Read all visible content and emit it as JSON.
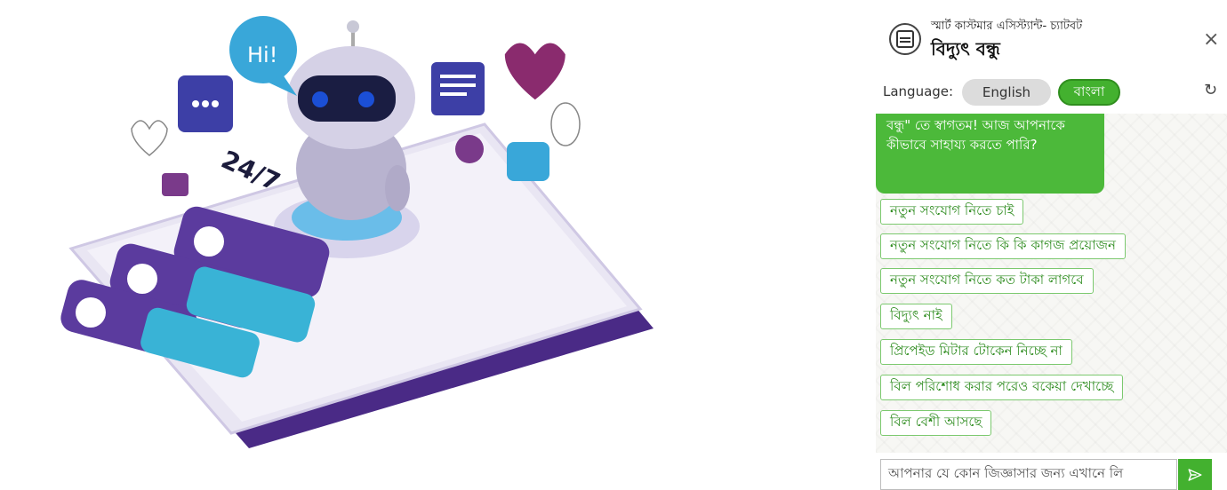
{
  "illustration": {
    "speech_hi": "Hi!",
    "badge_247": "24/7"
  },
  "chat": {
    "header": {
      "subtitle": "স্মার্ট কাস্টমার এসিস্ট্যান্ট- চ্যাটবট",
      "title": "বিদ্যুৎ বন্ধু"
    },
    "close_icon": "×",
    "language": {
      "label": "Language:",
      "options": [
        "English",
        "বাংলা"
      ],
      "selected": "বাংলা"
    },
    "refresh_icon": "↻",
    "bot_message": "বন্ধু\" তে স্বাগতম! আজ আপনাকে কীভাবে সাহায্য করতে পারি?",
    "quick_replies": [
      "নতুন সংযোগ নিতে চাই",
      "নতুন সংযোগ নিতে কি কি কাগজ প্রয়োজন",
      "নতুন সংযোগ নিতে কত টাকা লাগবে",
      "বিদ্যুৎ নাই",
      "প্রিপেইড মিটার টোকেন নিচ্ছে না",
      "বিল পরিশোধ করার পরেও বকেয়া দেখাচ্ছে",
      "বিল বেশী আসছে"
    ],
    "input_placeholder": "আপনার যে কোন জিজ্ঞাসার জন্য এখানে লি",
    "send_icon": "send-icon"
  },
  "colors": {
    "accent_green": "#43b12f",
    "bot_bubble": "#4cb93a",
    "option_text": "#2e8c1f",
    "phone_purple": "#4a2a86",
    "robot_blue": "#1b4fd6"
  }
}
